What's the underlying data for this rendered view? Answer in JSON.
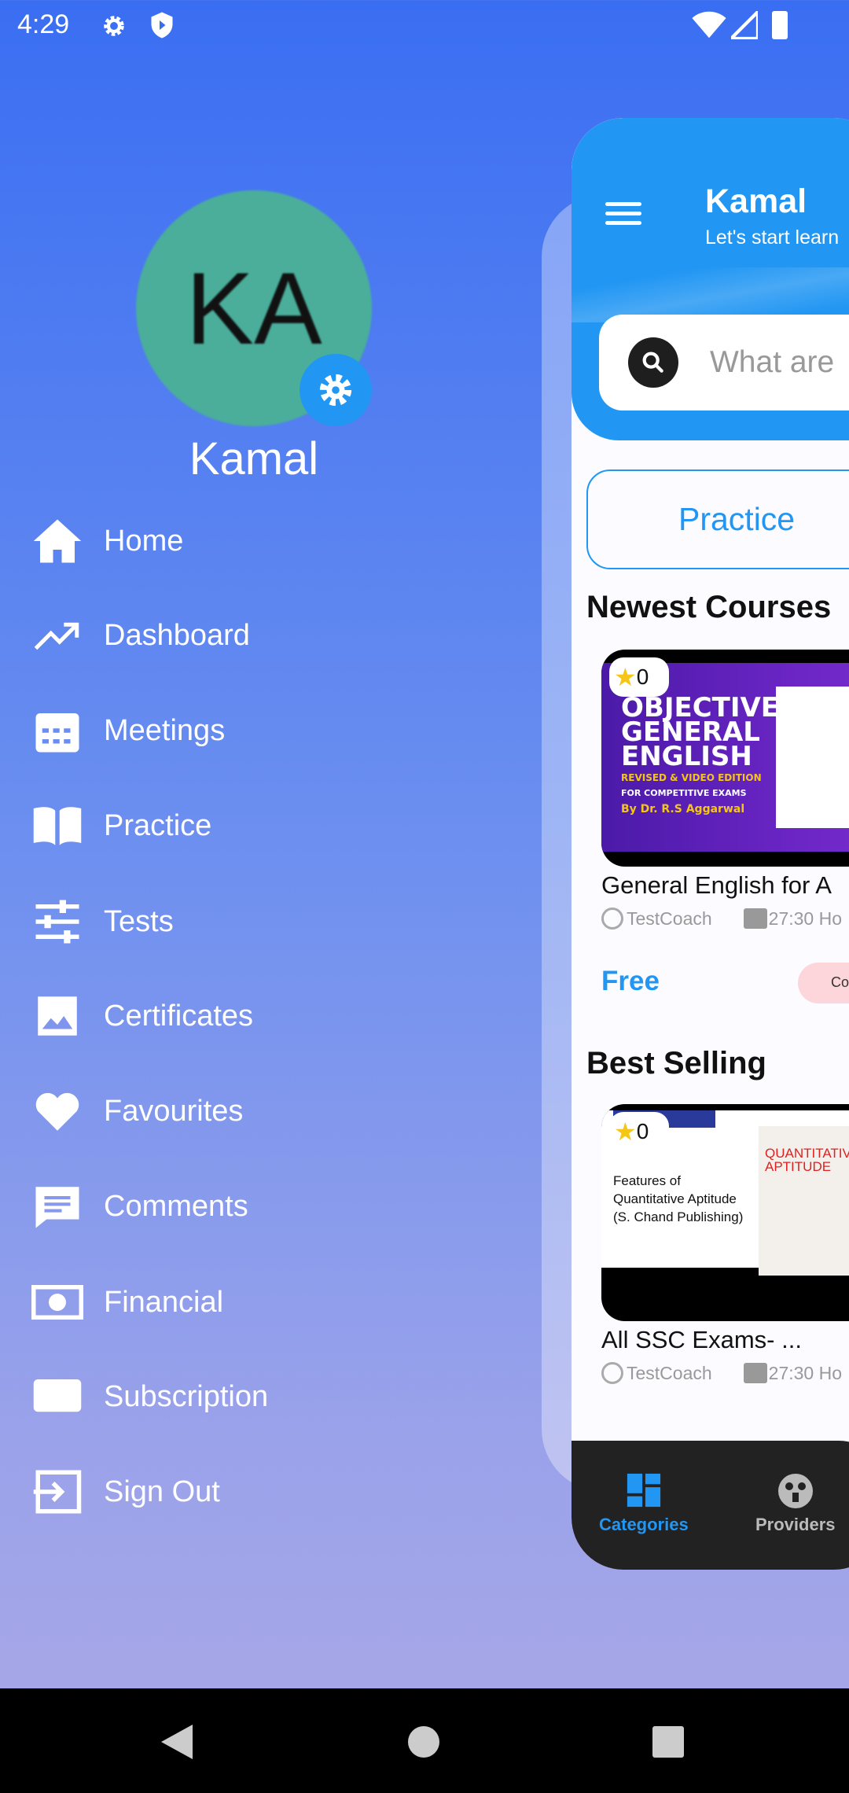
{
  "status_bar": {
    "time": "4:29",
    "icons": [
      "settings-icon",
      "shield-icon",
      "wifi-icon",
      "signal-icon",
      "battery-icon"
    ]
  },
  "drawer": {
    "avatar_initials": "KA",
    "user_name": "Kamal",
    "items": [
      {
        "label": "Home",
        "icon": "home-icon"
      },
      {
        "label": "Dashboard",
        "icon": "trending-up-icon"
      },
      {
        "label": "Meetings",
        "icon": "calendar-icon"
      },
      {
        "label": "Practice",
        "icon": "book-icon"
      },
      {
        "label": "Tests",
        "icon": "sliders-icon"
      },
      {
        "label": "Certificates",
        "icon": "image-icon"
      },
      {
        "label": "Favourites",
        "icon": "heart-icon"
      },
      {
        "label": "Comments",
        "icon": "comment-icon"
      },
      {
        "label": "Financial",
        "icon": "money-icon"
      },
      {
        "label": "Subscription",
        "icon": "monitor-icon"
      },
      {
        "label": "Sign Out",
        "icon": "sign-out-icon"
      }
    ]
  },
  "main": {
    "header": {
      "title": "Kamal",
      "subtitle": "Let's start learn"
    },
    "search": {
      "placeholder": "What are"
    },
    "practice_label": "Practice",
    "newest": {
      "title": "Newest Courses",
      "course": {
        "rating": "0",
        "image_text": [
          "OBJECTIVE",
          "GENERAL",
          "ENGLISH",
          "REVISED & VIDEO EDITION",
          "FOR COMPETITIVE EXAMS",
          "By Dr. R.S Aggarwal"
        ],
        "title": "General English for A",
        "provider": "TestCoach",
        "duration": "27:30 Ho",
        "price": "Free",
        "pill": "Co"
      }
    },
    "best": {
      "title": "Best Selling",
      "course": {
        "rating": "0",
        "image_text": [
          "Features of",
          "Quantitative Aptitude",
          "(S. Chand Publishing)",
          "QUANTITATIVE",
          "APTITUDE"
        ],
        "title": "All SSC Exams- ...",
        "provider": "TestCoach",
        "duration": "27:30 Ho"
      }
    },
    "bottom_nav": [
      {
        "label": "Categories",
        "icon": "grid-icon",
        "active": true
      },
      {
        "label": "Providers",
        "icon": "providers-icon",
        "active": false
      }
    ]
  },
  "colors": {
    "accent": "#2196f3",
    "nav_bg": "#222222"
  }
}
